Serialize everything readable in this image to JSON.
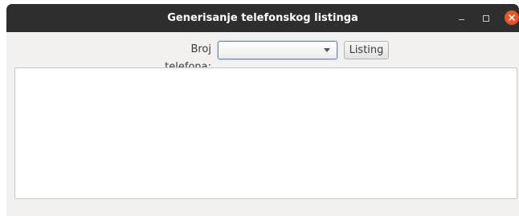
{
  "window": {
    "title": "Generisanje telefonskog listinga"
  },
  "window_controls": {
    "minimize_icon": "minimize-icon",
    "maximize_icon": "maximize-icon",
    "close_icon": "close-icon",
    "close_color": "#e95420"
  },
  "form": {
    "phone_label": "Broj telefona:",
    "phone_select_value": "",
    "listing_button_label": "Listing"
  },
  "output": {
    "text": ""
  }
}
